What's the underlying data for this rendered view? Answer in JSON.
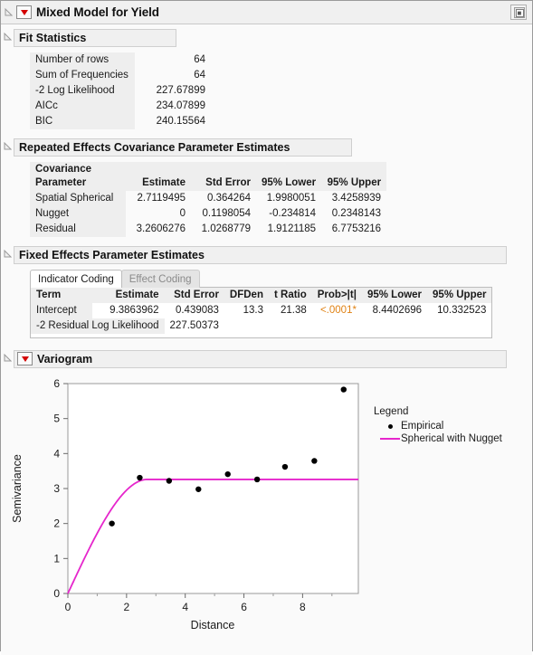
{
  "window": {
    "title": "Mixed Model for Yield",
    "corner_icon": "window-layers-icon"
  },
  "fit_statistics": {
    "header": "Fit Statistics",
    "rows": [
      {
        "label": "Number of rows",
        "value": "64"
      },
      {
        "label": "Sum of Frequencies",
        "value": "64"
      },
      {
        "label": "-2 Log Likelihood",
        "value": "227.67899"
      },
      {
        "label": "AICc",
        "value": "234.07899"
      },
      {
        "label": "BIC",
        "value": "240.15564"
      }
    ]
  },
  "repeated_effects": {
    "header": "Repeated Effects Covariance Parameter Estimates",
    "columns": [
      "Covariance Parameter",
      "Estimate",
      "Std Error",
      "95% Lower",
      "95% Upper"
    ],
    "col_head_line1": "Covariance",
    "col_head_line2": "Parameter",
    "rows": [
      {
        "parameter": "Spatial Spherical",
        "estimate": "2.7119495",
        "std_error": "0.364264",
        "lower": "1.9980051",
        "upper": "3.4258939"
      },
      {
        "parameter": "Nugget",
        "estimate": "0",
        "std_error": "0.1198054",
        "lower": "-0.234814",
        "upper": "0.2348143"
      },
      {
        "parameter": "Residual",
        "estimate": "3.2606276",
        "std_error": "1.0268779",
        "lower": "1.9121185",
        "upper": "6.7753216"
      }
    ]
  },
  "fixed_effects": {
    "header": "Fixed Effects Parameter Estimates",
    "tabs": [
      {
        "label": "Indicator Coding",
        "active": true
      },
      {
        "label": "Effect Coding",
        "active": false
      }
    ],
    "columns": [
      "Term",
      "Estimate",
      "Std Error",
      "DFDen",
      "t Ratio",
      "Prob>|t|",
      "95% Lower",
      "95% Upper"
    ],
    "rows": [
      {
        "term": "Intercept",
        "estimate": "9.3863962",
        "std_error": "0.439083",
        "dfden": "13.3",
        "t_ratio": "21.38",
        "prob": "<.0001*",
        "lower": "8.4402696",
        "upper": "10.332523"
      }
    ],
    "residual_label": "-2 Residual Log Likelihood",
    "residual_value": "227.50373",
    "pvalue_color": "#e08214"
  },
  "variogram": {
    "header": "Variogram",
    "legend_title": "Legend",
    "legend": [
      {
        "label": "Empirical",
        "marker": "dot",
        "color": "#000000"
      },
      {
        "label": "Spherical with Nugget",
        "marker": "line",
        "color": "#e626cc"
      }
    ]
  },
  "chart_data": {
    "type": "scatter",
    "title": "Variogram",
    "xlabel": "Distance",
    "ylabel": "Semivariance",
    "xlim": [
      0,
      9.9
    ],
    "ylim": [
      0,
      6
    ],
    "xticks": [
      0,
      2,
      4,
      6,
      8
    ],
    "yticks": [
      0,
      1,
      2,
      3,
      4,
      5,
      6
    ],
    "grid": false,
    "legend_position": "right",
    "series": [
      {
        "name": "Empirical",
        "type": "scatter",
        "color": "#000000",
        "x": [
          1.5,
          2.45,
          3.45,
          4.45,
          5.45,
          6.45,
          7.4,
          8.4,
          9.4
        ],
        "y": [
          2.0,
          3.31,
          3.22,
          2.98,
          3.41,
          3.26,
          3.62,
          3.79,
          5.83
        ]
      },
      {
        "name": "Spherical with Nugget",
        "type": "line",
        "color": "#e626cc",
        "model": "spherical",
        "nugget": 0,
        "sill": 3.2606276,
        "range": 2.7119495
      }
    ]
  }
}
